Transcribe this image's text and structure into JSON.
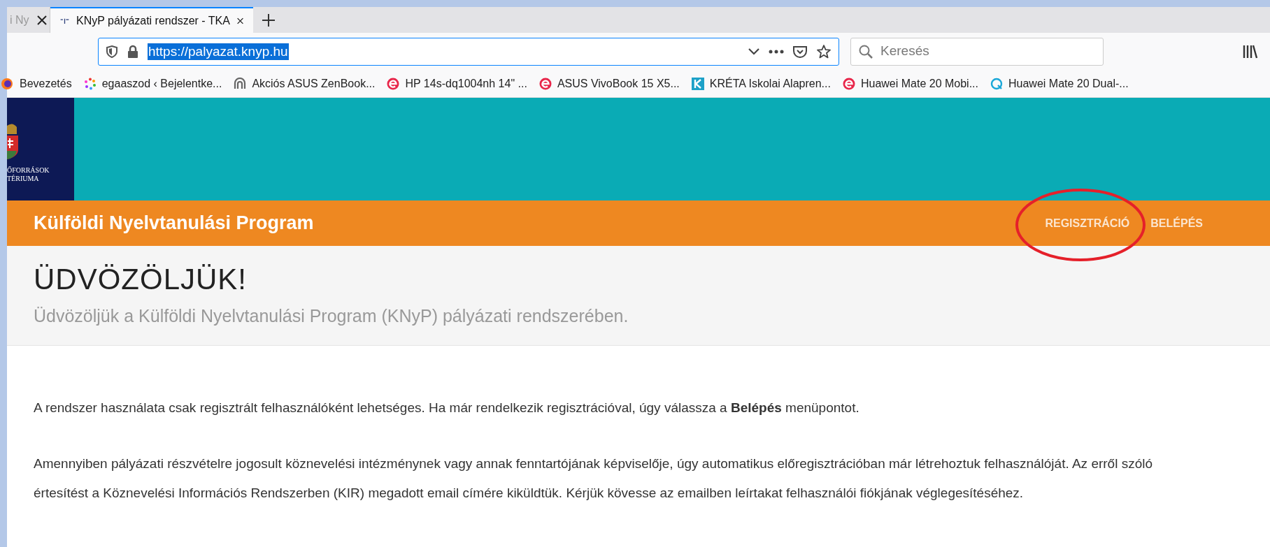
{
  "browser": {
    "tabs": [
      {
        "label": "i Ny",
        "selected": false
      },
      {
        "label": "KNyP pályázati rendszer - TKA",
        "selected": true
      }
    ],
    "url": "https://palyazat.knyp.hu",
    "search": {
      "placeholder": "Keresés"
    },
    "bookmarks": [
      {
        "label": "Bevezetés"
      },
      {
        "label": "egaaszod ‹ Bejelentke..."
      },
      {
        "label": "Akciós ASUS ZenBook..."
      },
      {
        "label": "HP 14s-dq1004nh 14\" ..."
      },
      {
        "label": "ASUS VivoBook 15 X5..."
      },
      {
        "label": "KRÉTA Iskolai Alapren..."
      },
      {
        "label": "Huawei Mate 20 Mobi..."
      },
      {
        "label": "Huawei Mate 20 Dual-..."
      }
    ]
  },
  "page": {
    "logo_lines": [
      "ŐFORRÁSOK",
      "TÉRIUMA"
    ],
    "program_title": "Külföldi Nyelvtanulási Program",
    "nav": [
      {
        "label": "REGISZTRÁCIÓ",
        "circled": true
      },
      {
        "label": "BELÉPÉS",
        "circled": false
      }
    ],
    "heading": "ÜDVÖZÖLJÜK!",
    "subheading": "Üdvözöljük a Külföldi Nyelvtanulási Program (KNyP) pályázati rendszerében.",
    "paragraphs": [
      "A rendszer használata csak regisztrált felhasználóként lehetséges. Ha már rendelkezik regisztrációval, úgy válassza a **Belépés** menüpontot.",
      "Amennyiben pályázati részvételre jogosult köznevelési intézménynek vagy annak fenntartójának képviselője, úgy automatikus előregisztrációban már létrehoztuk felhasználóját. Az erről szóló értesítést a Köznevelési Információs Rendszerben (KIR) megadott email címére kiküldtük. Kérjük kövesse az emailben leírtakat felhasználói fiókjának véglegesítéséhez."
    ]
  }
}
